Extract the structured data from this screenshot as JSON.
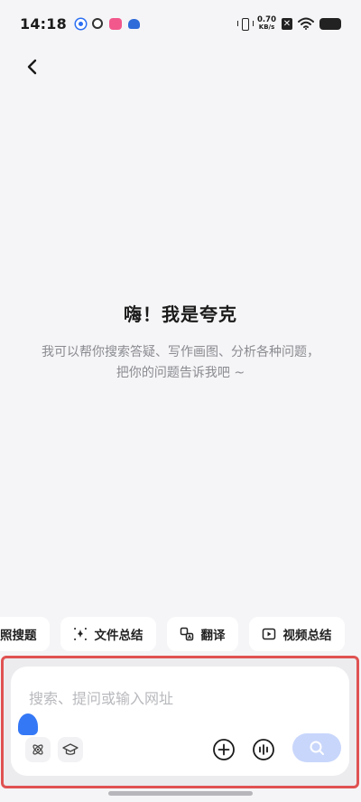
{
  "status_bar": {
    "time": "14:18",
    "net_speed_value": "0.70",
    "net_speed_unit": "KB/s",
    "notifications": [
      "location-app-icon",
      "quark-app-icon",
      "red-app-icon",
      "bird-app-icon"
    ]
  },
  "nav": {
    "back_icon": "chevron-left-icon"
  },
  "welcome": {
    "title": "嗨！我是夸克",
    "subtitle_line1": "我可以帮你搜索答疑、写作画图、分析各种问题，",
    "subtitle_line2": "把你的问题告诉我吧 ~"
  },
  "quick_actions": [
    {
      "label": "照搜题",
      "icon": "camera-icon"
    },
    {
      "label": "文件总结",
      "icon": "document-sparkle-icon"
    },
    {
      "label": "翻译",
      "icon": "translate-icon"
    },
    {
      "label": "视频总结",
      "icon": "play-icon"
    }
  ],
  "input": {
    "placeholder": "搜索、提问或输入网址",
    "value": ""
  },
  "colors": {
    "accent": "#3478f6",
    "search_button": "#c8d6fb",
    "highlight_border": "#e05252",
    "background": "#f5f5f7"
  }
}
